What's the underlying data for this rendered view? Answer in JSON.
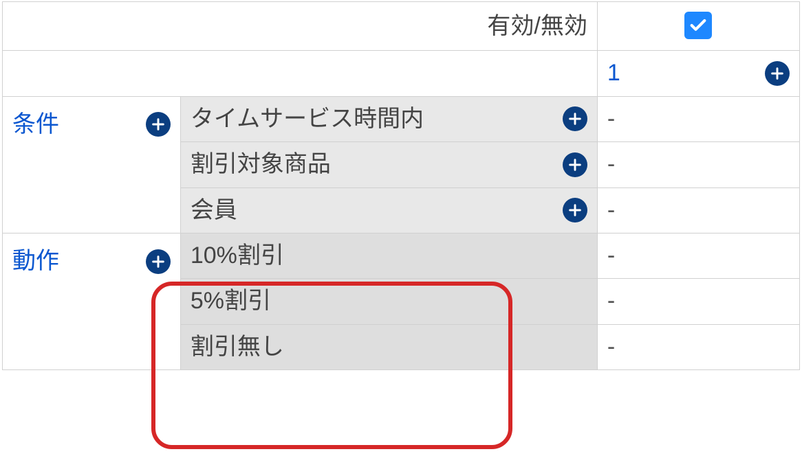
{
  "header": {
    "enabled_label": "有効/無効",
    "rule_number": "1"
  },
  "sections": {
    "conditions_label": "条件",
    "actions_label": "動作"
  },
  "conditions": [
    {
      "label": "タイムサービス時間内",
      "value": "-"
    },
    {
      "label": "割引対象商品",
      "value": "-"
    },
    {
      "label": "会員",
      "value": "-"
    }
  ],
  "actions": [
    {
      "label": "10%割引",
      "value": "-"
    },
    {
      "label": "5%割引",
      "value": "-"
    },
    {
      "label": "割引無し",
      "value": "-"
    }
  ],
  "icons": {
    "plus": "plus-circle-icon",
    "check": "checkbox-checked-icon"
  }
}
